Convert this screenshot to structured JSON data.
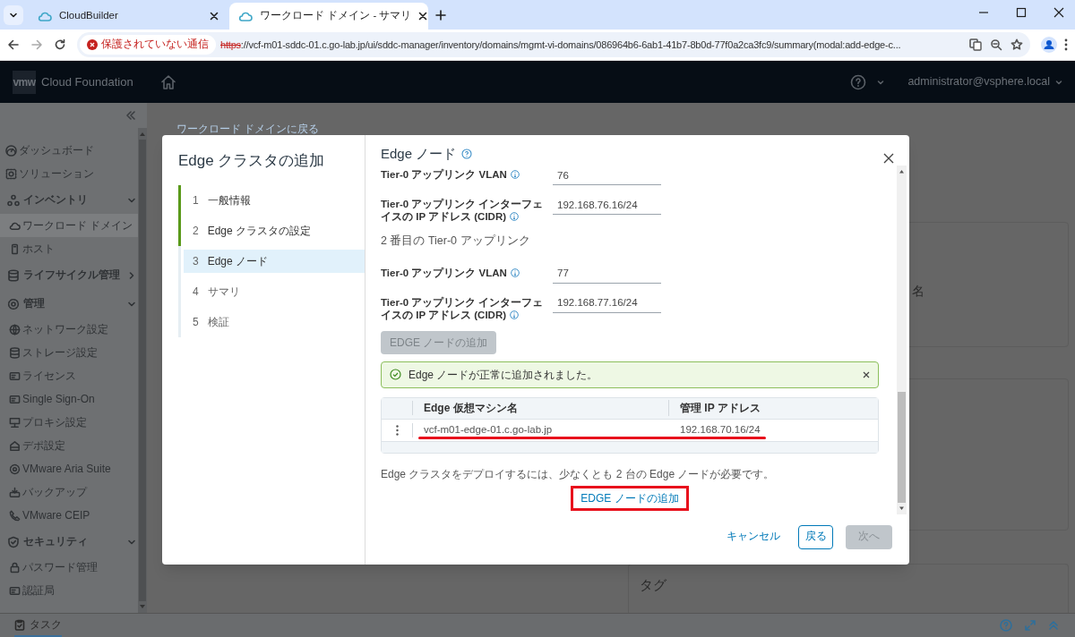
{
  "browser": {
    "tabs": [
      {
        "title": "CloudBuilder",
        "selected": false
      },
      {
        "title": "ワークロード ドメイン - サマリ",
        "selected": true
      }
    ],
    "security_label": "保護されていない通信",
    "url_scheme": "https",
    "url_rest": "://vcf-m01-sddc-01.c.go-lab.jp/ui/sddc-manager/inventory/domains/mgmt-vi-domains/086964b6-6ab1-41b7-8b0d-77f0a2ca3fc9/summary(modal:add-edge-c..."
  },
  "header": {
    "logo": "vmw",
    "product": "Cloud Foundation",
    "user": "administrator@vsphere.local"
  },
  "sidebar": {
    "items": [
      {
        "kind": "item",
        "label": "ダッシュボード",
        "selected": false
      },
      {
        "kind": "item",
        "label": "ソリューション",
        "selected": false
      },
      {
        "kind": "group",
        "label": "インベントリ",
        "expanded": true,
        "children": [
          {
            "label": "ワークロード ドメイン",
            "selected": true
          },
          {
            "label": "ホスト",
            "selected": false
          }
        ]
      },
      {
        "kind": "group",
        "label": "ライフサイクル管理",
        "expanded": false
      },
      {
        "kind": "group",
        "label": "管理",
        "expanded": true,
        "children": [
          {
            "label": "ネットワーク設定",
            "selected": false
          },
          {
            "label": "ストレージ設定",
            "selected": false
          },
          {
            "label": "ライセンス",
            "selected": false
          },
          {
            "label": "Single Sign-On",
            "selected": false
          },
          {
            "label": "プロキシ設定",
            "selected": false
          },
          {
            "label": "デポ設定",
            "selected": false
          },
          {
            "label": "VMware Aria Suite",
            "selected": false
          },
          {
            "label": "バックアップ",
            "selected": false
          },
          {
            "label": "VMware CEIP",
            "selected": false
          }
        ]
      },
      {
        "kind": "group",
        "label": "セキュリティ",
        "expanded": true,
        "children": [
          {
            "label": "パスワード管理",
            "selected": false
          },
          {
            "label": "認証局",
            "selected": false
          }
        ]
      }
    ]
  },
  "background": {
    "back_link": "ワークロード ドメインに戻る",
    "fragment": "名",
    "tags_title": "タグ"
  },
  "modal": {
    "title": "Edge クラスタの追加",
    "steps": [
      {
        "number": "1",
        "label": "一般情報",
        "completed": true,
        "selected": false
      },
      {
        "number": "2",
        "label": "Edge クラスタの設定",
        "completed": true,
        "selected": false
      },
      {
        "number": "3",
        "label": "Edge ノード",
        "completed": false,
        "selected": true
      },
      {
        "number": "4",
        "label": "サマリ",
        "completed": false,
        "selected": false
      },
      {
        "number": "5",
        "label": "検証",
        "completed": false,
        "selected": false
      }
    ],
    "heading": "Edge ノード",
    "content": [
      {
        "kind": "field",
        "label": "Tier-0 アップリンク VLAN",
        "value": "76"
      },
      {
        "kind": "field",
        "label": "Tier-0 アップリンク インターフェイスの IP アドレス (CIDR)",
        "value": "192.168.76.16/24"
      },
      {
        "kind": "heading",
        "label": "2 番目の Tier-0 アップリンク"
      },
      {
        "kind": "field",
        "label": "Tier-0 アップリンク VLAN",
        "value": "77"
      },
      {
        "kind": "field",
        "label": "Tier-0 アップリンク インターフェイスの IP アドレス (CIDR)",
        "value": "192.168.77.16/24"
      },
      {
        "kind": "button",
        "label": "EDGE ノードの追加",
        "disabled": true
      }
    ],
    "alert": {
      "text": "Edge ノードが正常に追加されました。"
    },
    "table": {
      "columns": [
        "Edge 仮想マシン名",
        "管理 IP アドレス"
      ],
      "rows": [
        {
          "cells": [
            "vcf-m01-edge-01.c.go-lab.jp",
            "192.168.70.16/24"
          ],
          "underlined": true
        }
      ]
    },
    "note": "Edge クラスタをデプロイするには、少なくとも 2 台の Edge ノードが必要です。",
    "add_link": {
      "label": "EDGE ノードの追加",
      "highlighted": true
    },
    "buttons": [
      {
        "kind": "link",
        "label": "キャンセル",
        "disabled": false
      },
      {
        "kind": "outline",
        "label": "戻る",
        "disabled": false
      },
      {
        "kind": "solid",
        "label": "次へ",
        "disabled": true
      }
    ]
  },
  "taskbar": {
    "label": "タスク"
  }
}
